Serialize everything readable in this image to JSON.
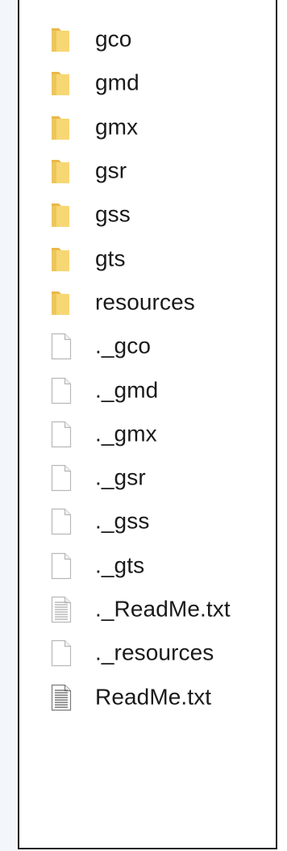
{
  "files": [
    {
      "name": "gco",
      "type": "folder",
      "icon": "folder-icon"
    },
    {
      "name": "gmd",
      "type": "folder",
      "icon": "folder-icon"
    },
    {
      "name": "gmx",
      "type": "folder",
      "icon": "folder-icon"
    },
    {
      "name": "gsr",
      "type": "folder",
      "icon": "folder-icon"
    },
    {
      "name": "gss",
      "type": "folder",
      "icon": "folder-icon"
    },
    {
      "name": "gts",
      "type": "folder",
      "icon": "folder-icon"
    },
    {
      "name": "resources",
      "type": "folder",
      "icon": "folder-icon"
    },
    {
      "name": "._gco",
      "type": "file",
      "icon": "blank-file-icon"
    },
    {
      "name": "._gmd",
      "type": "file",
      "icon": "blank-file-icon"
    },
    {
      "name": "._gmx",
      "type": "file",
      "icon": "blank-file-icon"
    },
    {
      "name": "._gsr",
      "type": "file",
      "icon": "blank-file-icon"
    },
    {
      "name": "._gss",
      "type": "file",
      "icon": "blank-file-icon"
    },
    {
      "name": "._gts",
      "type": "file",
      "icon": "blank-file-icon"
    },
    {
      "name": "._ReadMe.txt",
      "type": "text",
      "icon": "text-file-icon"
    },
    {
      "name": "._resources",
      "type": "file",
      "icon": "blank-file-icon"
    },
    {
      "name": "ReadMe.txt",
      "type": "text-dark",
      "icon": "text-file-icon"
    }
  ],
  "colors": {
    "folder_fill": "#f7d774",
    "folder_tab": "#e8b84a",
    "file_border": "#b8b8b8",
    "text": "#1a1a1a"
  }
}
